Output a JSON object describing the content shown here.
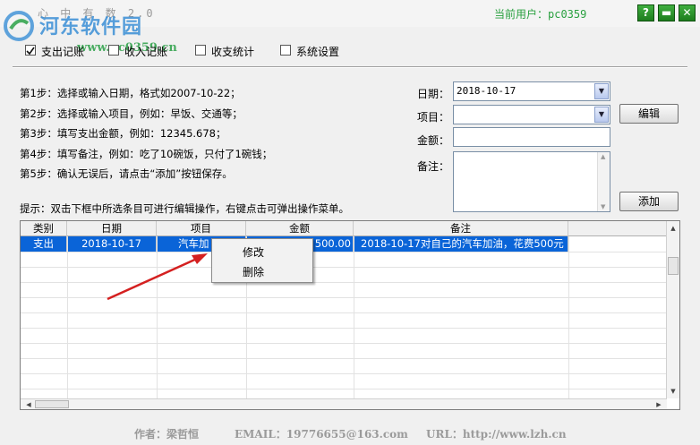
{
  "app": {
    "title": "心 中 有 数 2.0"
  },
  "watermark": {
    "site": "河东软件园",
    "url": "www.pc0359.cn"
  },
  "user": {
    "label": "当前用户：pc0359"
  },
  "window_buttons": {
    "help": "?",
    "minimize": "▬",
    "close": "✕"
  },
  "tabs": [
    {
      "label": "支出记账",
      "checked": true
    },
    {
      "label": "收入记账",
      "checked": false
    },
    {
      "label": "收支统计",
      "checked": false
    },
    {
      "label": "系统设置",
      "checked": false
    }
  ],
  "steps": [
    "第1步：选择或输入日期，格式如2007-10-22；",
    "第2步：选择或输入项目，例如：早饭、交通等；",
    "第3步：填写支出金额，例如：12345.678；",
    "第4步：填写备注，例如：吃了10碗饭，只付了1碗钱；",
    "第5步：确认无误后，请点击“添加”按钮保存。"
  ],
  "form": {
    "date_label": "日期：",
    "date_value": "2018-10-17",
    "item_label": "项目：",
    "item_value": "",
    "amount_label": "金额：",
    "amount_value": "",
    "note_label": "备注：",
    "note_value": "",
    "edit_button": "编辑",
    "add_button": "添加"
  },
  "hint": "提示：双击下框中所选条目可进行编辑操作，右键点击可弹出操作菜单。",
  "table": {
    "columns": [
      "类别",
      "日期",
      "项目",
      "金额",
      "备注"
    ],
    "rows": [
      [
        "支出",
        "2018-10-17",
        "汽车加",
        "500.00",
        "2018-10-17对自己的汽车加油，花费500元"
      ]
    ]
  },
  "context_menu": {
    "items": [
      "修改",
      "删除"
    ]
  },
  "footer": {
    "author": "作者：梁哲恒",
    "email": "EMAIL：19776655@163.com",
    "url": "URL：http://www.lzh.cn"
  },
  "colors": {
    "accent": "#0a64d8",
    "user_text": "#2aa040",
    "arrow": "#d42020"
  }
}
